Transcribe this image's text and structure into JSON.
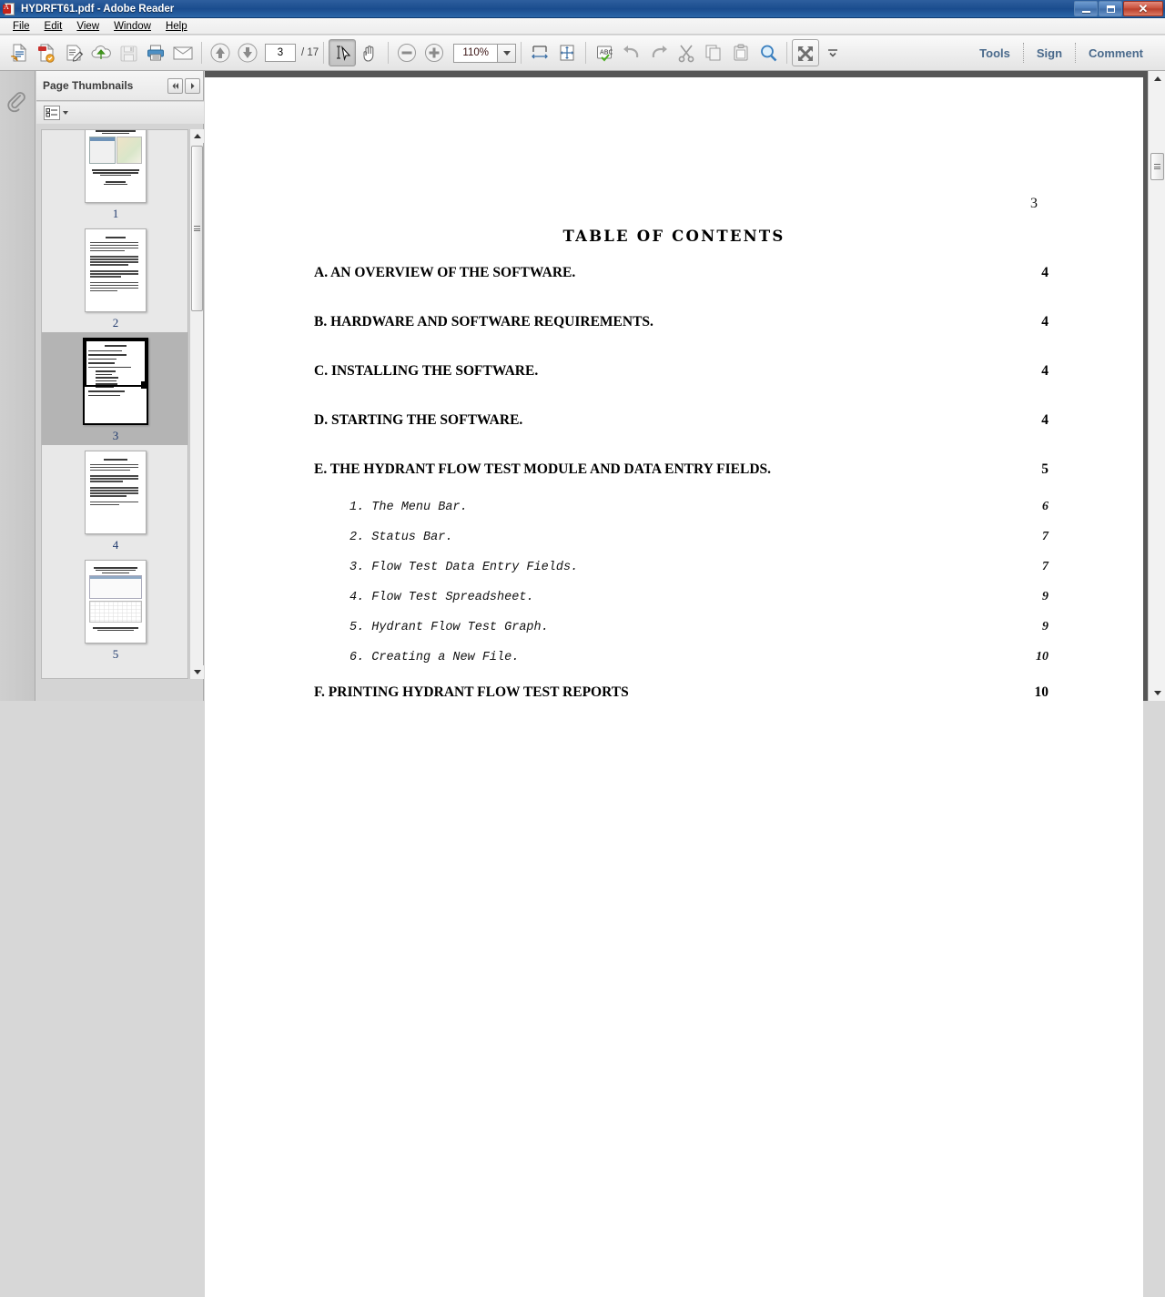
{
  "window": {
    "title": "HYDRFT61.pdf - Adobe Reader",
    "app_icon": "pdf-document-icon",
    "minimize_label": "Minimize",
    "restore_label": "Restore",
    "close_label": "Close"
  },
  "menubar": {
    "items": [
      {
        "label": "File"
      },
      {
        "label": "Edit"
      },
      {
        "label": "View"
      },
      {
        "label": "Window"
      },
      {
        "label": "Help"
      }
    ]
  },
  "toolbar": {
    "buttons": [
      {
        "name": "open-pdf-icon",
        "title": "Open"
      },
      {
        "name": "create-pdf-icon",
        "title": "Create PDF"
      },
      {
        "name": "edit-pdf-icon",
        "title": "Edit PDF"
      },
      {
        "name": "upload-cloud-icon",
        "title": "Send files"
      },
      {
        "name": "save-icon",
        "title": "Save",
        "disabled": true
      },
      {
        "name": "print-icon",
        "title": "Print File"
      },
      {
        "name": "email-icon",
        "title": "Email"
      }
    ],
    "page_prev_icon": "arrow-up-circle-icon",
    "page_next_icon": "arrow-down-circle-icon",
    "page_number": "3",
    "page_total": "/ 17",
    "select_tool_icon": "select-text-icon",
    "hand_tool_icon": "hand-tool-icon",
    "zoom_out_icon": "zoom-out-icon",
    "zoom_in_icon": "zoom-in-icon",
    "zoom_level": "110%",
    "fit_width_icon": "fit-width-icon",
    "fit_page_icon": "fit-page-icon",
    "spellcheck_icon": "spellcheck-abc-icon",
    "undo_icon": "undo-icon",
    "redo_icon": "redo-icon",
    "cut_icon": "cut-scissors-icon",
    "copy_icon": "copy-icon",
    "paste_icon": "paste-icon",
    "find_icon": "search-magnifier-icon",
    "fullscreen_icon": "fullscreen-expand-icon",
    "more_tools_icon": "chevron-down-double-icon",
    "right_links": [
      {
        "label": "Tools"
      },
      {
        "label": "Sign"
      },
      {
        "label": "Comment"
      }
    ],
    "accent_color": "#4a6a8c"
  },
  "sidebar": {
    "rail_items": [
      {
        "name": "page-thumbnails-icon",
        "label": "Page Thumbnails"
      },
      {
        "name": "attachments-paperclip-icon",
        "label": "Attachments"
      }
    ],
    "panel_title": "Page Thumbnails",
    "nav_prev_icon": "double-chevron-left-icon",
    "nav_next_icon": "chevron-right-icon",
    "options_icon": "thumbnail-options-icon",
    "options_caret_icon": "caret-down-icon",
    "thumbnails": [
      {
        "label": "1",
        "kind": "title-with-image",
        "selected": false
      },
      {
        "label": "2",
        "kind": "dense-text",
        "selected": false
      },
      {
        "label": "3",
        "kind": "toc",
        "selected": true
      },
      {
        "label": "4",
        "kind": "dense-text",
        "selected": false
      },
      {
        "label": "5",
        "kind": "spreadsheet-chart",
        "selected": false
      }
    ]
  },
  "document": {
    "page_label": "3",
    "toc_heading": "TABLE OF CONTENTS",
    "entries": [
      {
        "text": "A. AN OVERVIEW OF THE SOFTWARE.",
        "page": "4",
        "level": "major"
      },
      {
        "text": "B. HARDWARE AND SOFTWARE REQUIREMENTS.",
        "page": "4",
        "level": "major"
      },
      {
        "text": "C. INSTALLING THE SOFTWARE.",
        "page": "4",
        "level": "major"
      },
      {
        "text": "D. STARTING THE SOFTWARE.",
        "page": "4",
        "level": "major"
      },
      {
        "text": "E. THE HYDRANT FLOW TEST MODULE AND DATA ENTRY FIELDS.",
        "page": "5",
        "level": "major"
      },
      {
        "text": "1. The Menu Bar.",
        "page": "6",
        "level": "minor"
      },
      {
        "text": "2. Status Bar.",
        "page": "7",
        "level": "minor"
      },
      {
        "text": "3. Flow Test Data Entry Fields.",
        "page": "7",
        "level": "minor"
      },
      {
        "text": "4. Flow Test Spreadsheet.",
        "page": "9",
        "level": "minor"
      },
      {
        "text": "5. Hydrant Flow Test Graph.",
        "page": "9",
        "level": "minor"
      },
      {
        "text": "6. Creating a New File.",
        "page": "10",
        "level": "minor"
      },
      {
        "text": "F. PRINTING HYDRANT FLOW TEST REPORTS",
        "page": "10",
        "level": "major"
      }
    ]
  },
  "scrollbars": {
    "main_up_icon": "scroll-up-arrow-icon",
    "main_down_icon": "scroll-down-arrow-icon",
    "panel_up_icon": "scroll-up-arrow-icon",
    "panel_down_icon": "scroll-down-arrow-icon"
  }
}
